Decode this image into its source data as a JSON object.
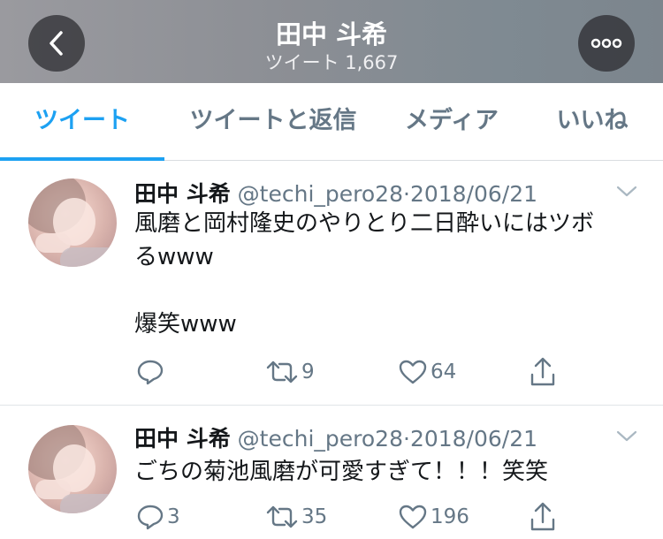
{
  "header": {
    "title": "田中 斗希",
    "subtitle": "ツイート 1,667",
    "back_icon": "chevron-left-icon",
    "more_icon": "more-horizontal-icon"
  },
  "tabs": [
    {
      "label": "ツイート",
      "active": true
    },
    {
      "label": "ツイートと返信",
      "active": false
    },
    {
      "label": "メディア",
      "active": false
    },
    {
      "label": "いいね",
      "active": false
    }
  ],
  "colors": {
    "accent": "#1da1f2",
    "muted": "#657786",
    "text": "#14171a"
  },
  "tweets": [
    {
      "name": "田中 斗希",
      "handle": "@techi_pero28",
      "sep": "·",
      "date": "2018/06/21",
      "lines": [
        "風磨と岡村隆史のやりとり二日酔いにはツボ",
        "るwww",
        "",
        "爆笑www"
      ],
      "replies": "",
      "retweets": "9",
      "likes": "64"
    },
    {
      "name": "田中 斗希",
      "handle": "@techi_pero28",
      "sep": "·",
      "date": "2018/06/21",
      "lines": [
        "ごちの菊池風磨が可愛すぎて！！！笑笑"
      ],
      "replies": "3",
      "retweets": "35",
      "likes": "196"
    }
  ]
}
